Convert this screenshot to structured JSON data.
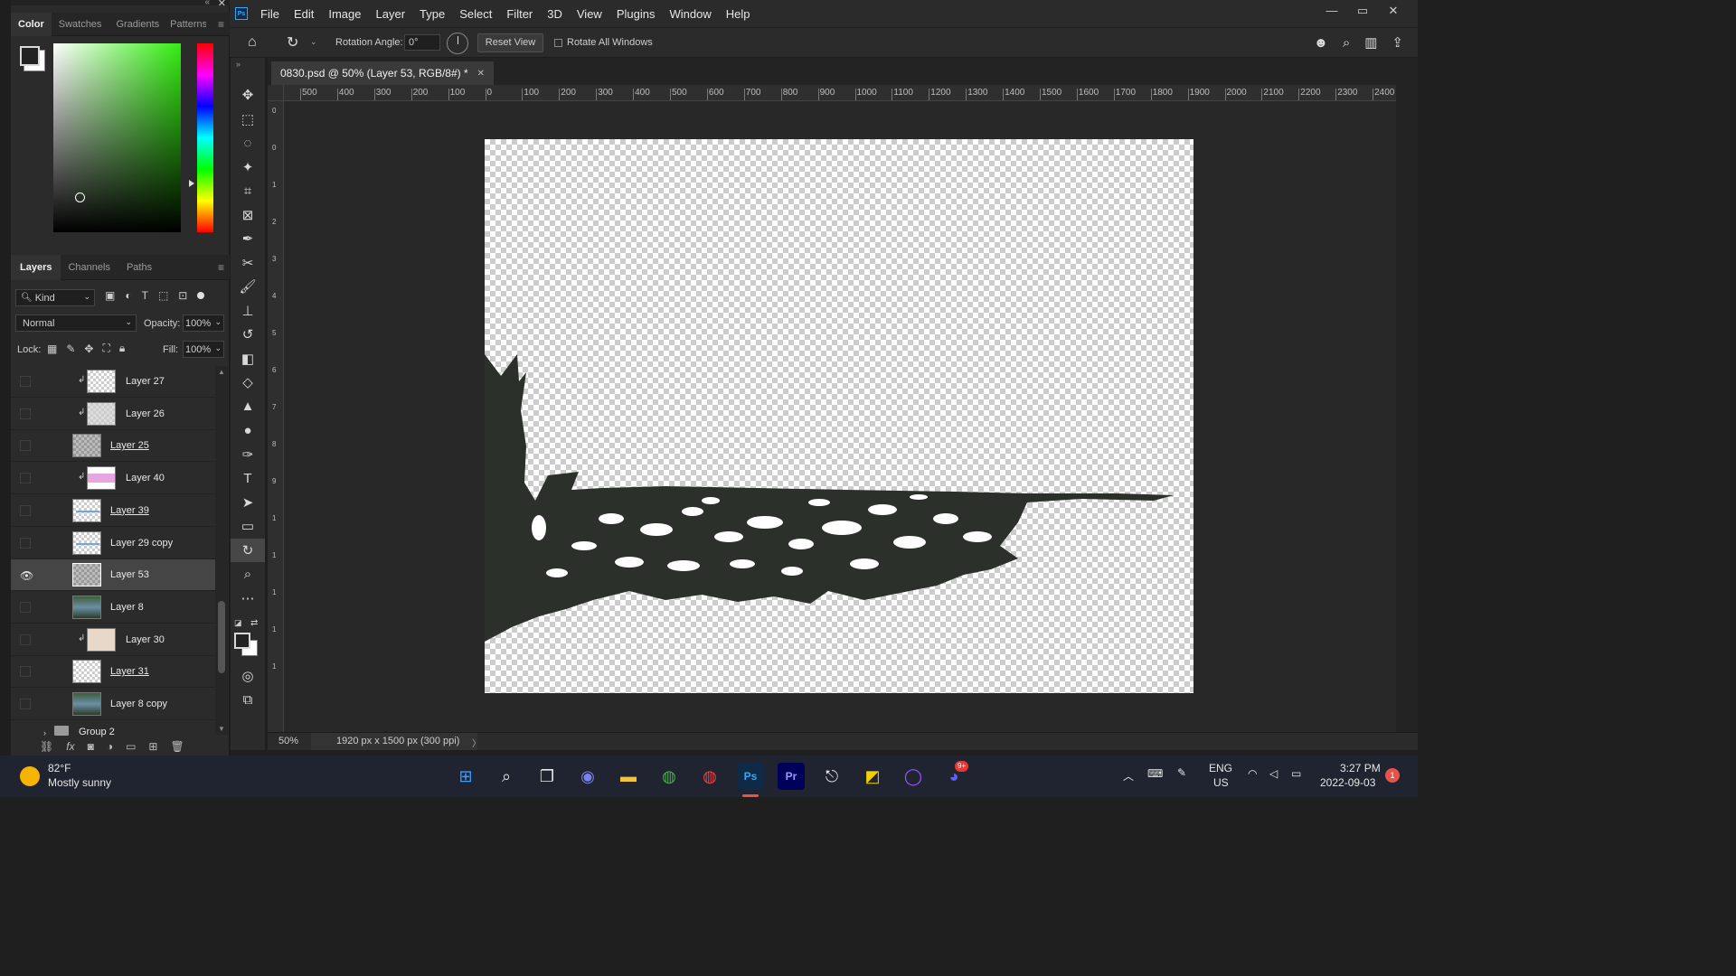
{
  "colors": {
    "ui_bg": "#2b2b2b",
    "canvas_artwork": "#2c302a",
    "accent_ps": "#31a8ff",
    "foreground_swatch": "#222222",
    "background_swatch": "#ffffff"
  },
  "color_panel": {
    "tabs": [
      "Color",
      "Swatches",
      "Gradients",
      "Patterns"
    ],
    "active_tab": "Color"
  },
  "menubar": {
    "app_logo": "Ps",
    "items": [
      "File",
      "Edit",
      "Image",
      "Layer",
      "Type",
      "Select",
      "Filter",
      "3D",
      "View",
      "Plugins",
      "Window",
      "Help"
    ]
  },
  "options_bar": {
    "rotation_label": "Rotation Angle:",
    "rotation_value": "0°",
    "reset_view": "Reset View",
    "rotate_all_windows": "Rotate All Windows"
  },
  "document": {
    "tab_title": "0830.psd @ 50% (Layer 53, RGB/8#) *",
    "zoom": "50%",
    "doc_info": "1920 px x 1500 px (300 ppi)",
    "ruler_top_labels": [
      "500",
      "400",
      "300",
      "200",
      "100",
      "0",
      "100",
      "200",
      "300",
      "400",
      "500",
      "600",
      "700",
      "800",
      "900",
      "1000",
      "1100",
      "1200",
      "1300",
      "1400",
      "1500",
      "1600",
      "1700",
      "1800",
      "1900",
      "2000",
      "2100",
      "2200",
      "2300",
      "2400"
    ],
    "ruler_left_labels": [
      "0",
      "0",
      "1",
      "2",
      "3",
      "4",
      "5",
      "6",
      "7",
      "8",
      "9",
      "1",
      "1",
      "1",
      "1",
      "1"
    ]
  },
  "layers_panel": {
    "tabs": [
      "Layers",
      "Channels",
      "Paths"
    ],
    "active_tab": "Layers",
    "filter_kind": "Kind",
    "blend_mode": "Normal",
    "opacity_label": "Opacity:",
    "opacity_value": "100%",
    "lock_label": "Lock:",
    "fill_label": "Fill:",
    "fill_value": "100%",
    "layers": [
      {
        "name": "Layer 27",
        "clipped": true,
        "underline": false,
        "visible": false,
        "selected": false,
        "thumb": "checker"
      },
      {
        "name": "Layer 26",
        "clipped": true,
        "underline": false,
        "visible": false,
        "selected": false,
        "thumb": "checker-gray"
      },
      {
        "name": "Layer 25",
        "clipped": false,
        "underline": true,
        "visible": false,
        "selected": false,
        "thumb": "checker-dark"
      },
      {
        "name": "Layer 40",
        "clipped": true,
        "underline": false,
        "visible": false,
        "selected": false,
        "thumb": "pink"
      },
      {
        "name": "Layer 39",
        "clipped": false,
        "underline": true,
        "visible": false,
        "selected": false,
        "thumb": "checker-blue"
      },
      {
        "name": "Layer 29 copy",
        "clipped": false,
        "underline": false,
        "visible": false,
        "selected": false,
        "thumb": "checker-blue"
      },
      {
        "name": "Layer 53",
        "clipped": false,
        "underline": false,
        "visible": true,
        "selected": true,
        "thumb": "checker-dark"
      },
      {
        "name": "Layer 8",
        "clipped": false,
        "underline": false,
        "visible": false,
        "selected": false,
        "thumb": "photo"
      },
      {
        "name": "Layer 30",
        "clipped": true,
        "underline": false,
        "visible": false,
        "selected": false,
        "thumb": "beige"
      },
      {
        "name": "Layer 31",
        "clipped": false,
        "underline": true,
        "visible": false,
        "selected": false,
        "thumb": "checker"
      },
      {
        "name": "Layer 8 copy",
        "clipped": false,
        "underline": false,
        "visible": false,
        "selected": false,
        "thumb": "photo"
      }
    ],
    "group_name": "Group 2"
  },
  "taskbar": {
    "weather_temp": "82°F",
    "weather_desc": "Mostly sunny",
    "language": "ENG",
    "region": "US",
    "time": "3:27 PM",
    "date": "2022-09-03",
    "notification_count": "1",
    "discord_badge": "9+"
  }
}
